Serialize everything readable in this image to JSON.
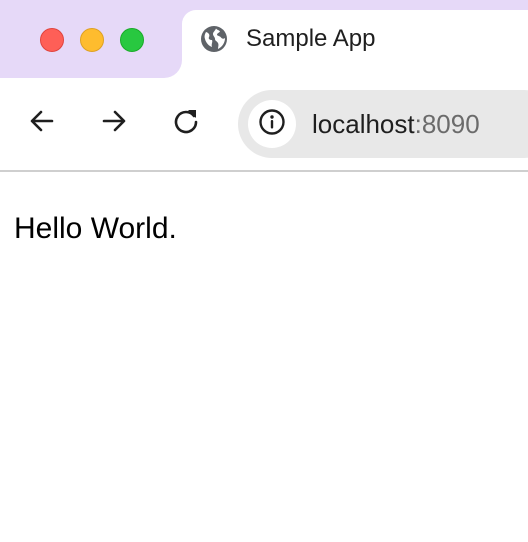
{
  "window": {
    "controls": {
      "close": "close",
      "minimize": "minimize",
      "maximize": "maximize"
    }
  },
  "tab": {
    "title": "Sample App",
    "favicon": "globe-icon"
  },
  "toolbar": {
    "back_icon": "arrow-left-icon",
    "forward_icon": "arrow-right-icon",
    "reload_icon": "reload-icon"
  },
  "address_bar": {
    "site_info_icon": "info-icon",
    "host": "localhost",
    "port": ":8090"
  },
  "page": {
    "body_text": "Hello World."
  },
  "colors": {
    "tab_strip_bg": "#e6d9f8",
    "close": "#fe5f57",
    "minimize": "#febc2e",
    "maximize": "#28c840",
    "omnibox_bg": "#e8e8e8"
  }
}
